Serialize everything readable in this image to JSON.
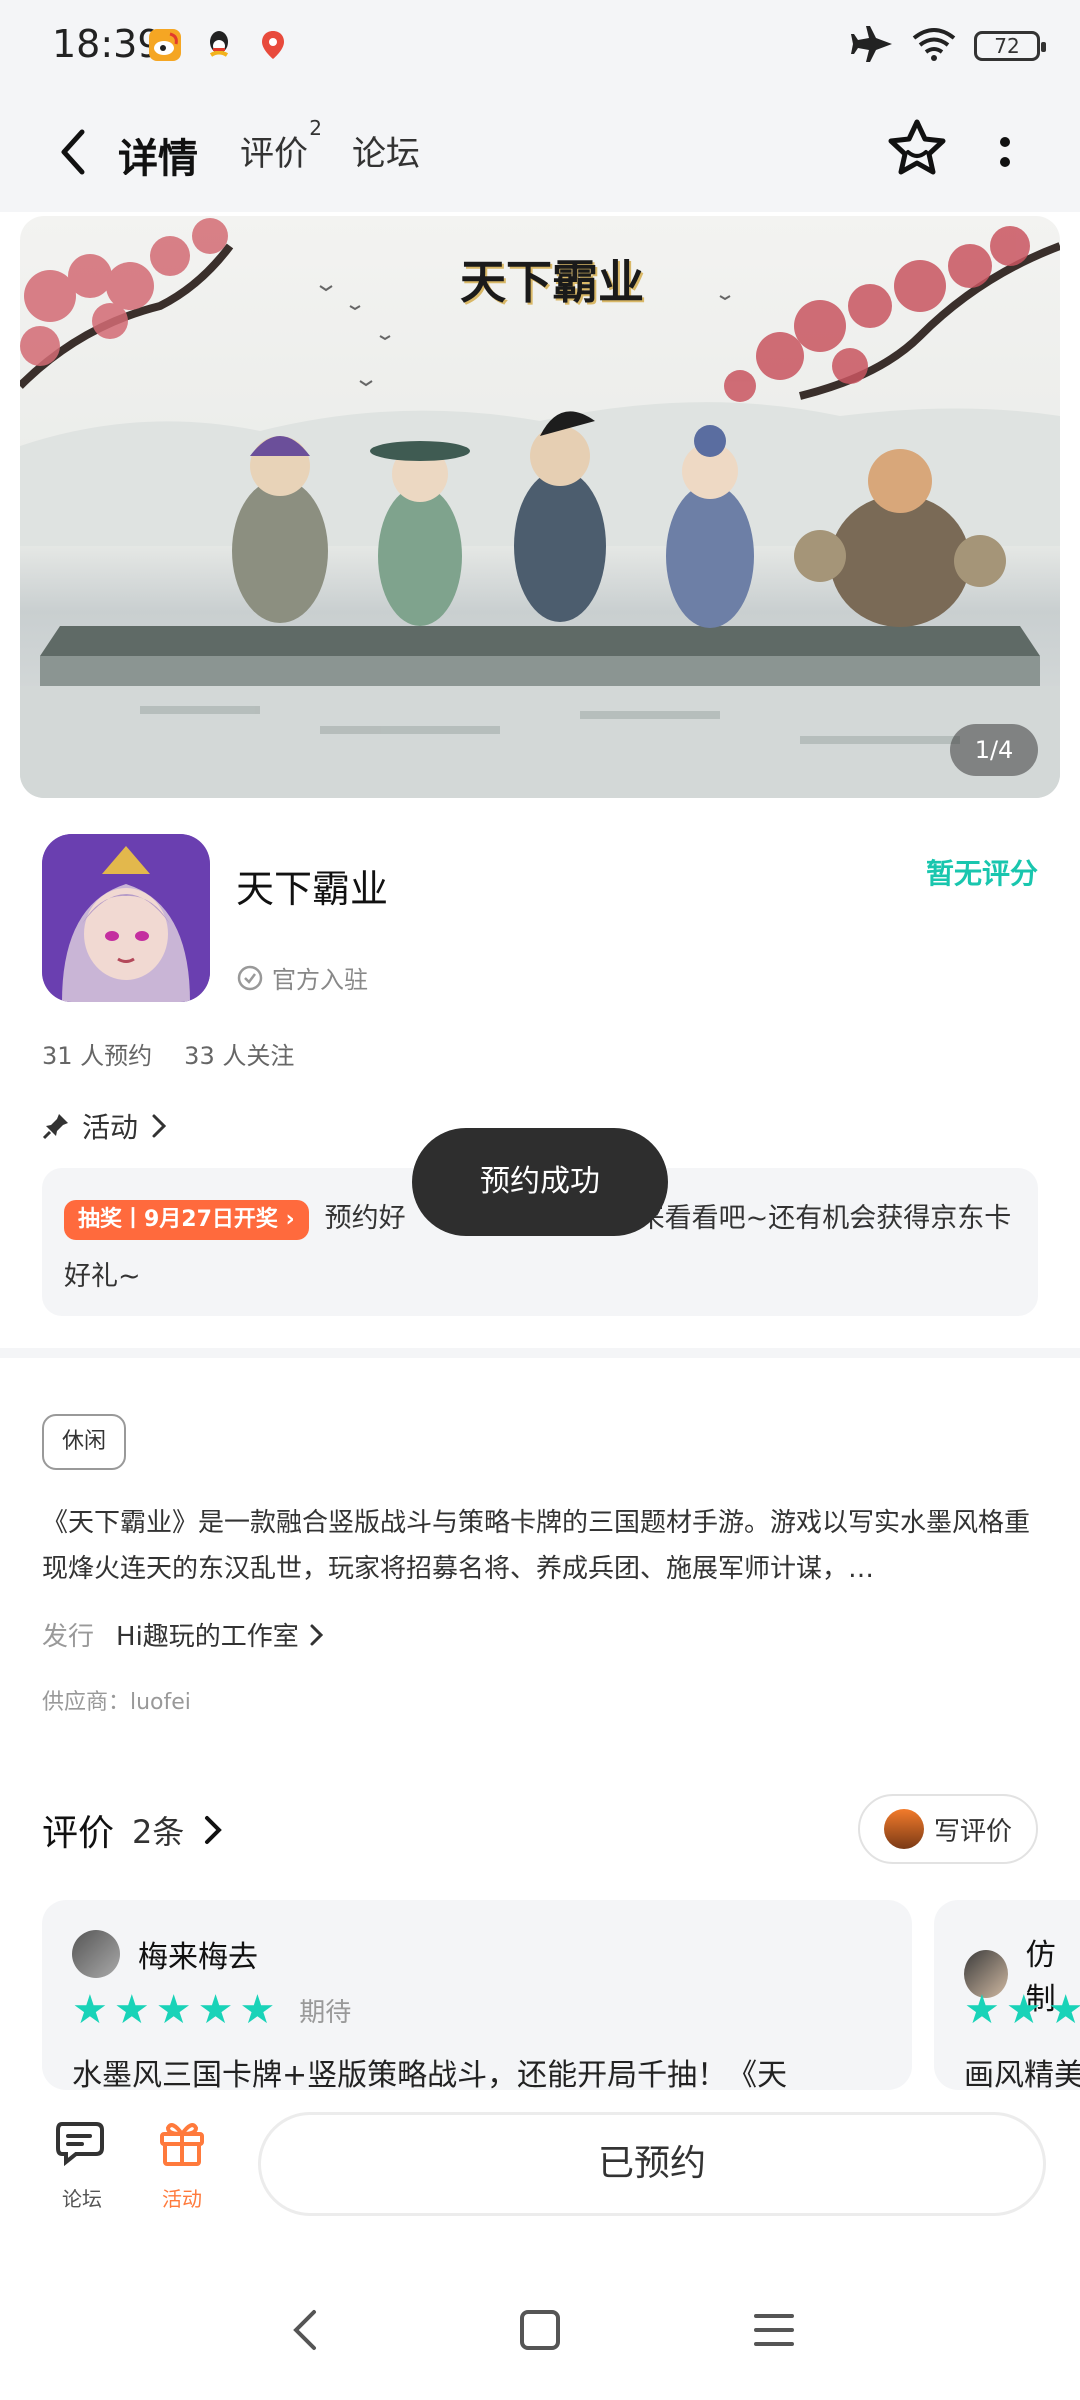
{
  "status_bar": {
    "time": "18:39",
    "battery": "72",
    "app_icons": [
      "weibo-icon",
      "qq-icon",
      "map-icon"
    ],
    "right_icons": [
      "airplane-icon",
      "wifi-icon",
      "battery-icon"
    ]
  },
  "nav": {
    "tabs": [
      {
        "label": "详情",
        "active": true
      },
      {
        "label": "评价",
        "badge": "2"
      },
      {
        "label": "论坛"
      }
    ]
  },
  "banner": {
    "logo_text": "天下霸业",
    "page_indicator": "1/4"
  },
  "game": {
    "name": "天下霸业",
    "official_label": "官方入驻",
    "rating_text": "暂无评分",
    "reservations": "31 人预约",
    "followers": "33 人关注"
  },
  "activity": {
    "heading": "活动",
    "badge": "抽奖丨9月27日开奖",
    "text_before": "预约好",
    "text_after": "来看看吧~还有机会获得京东卡好礼~"
  },
  "toast": "预约成功",
  "description": {
    "tag": "休闲",
    "text": "《天下霸业》是一款融合竖版战斗与策略卡牌的三国题材手游。游戏以写实水墨风格重现烽火连天的东汉乱世，玩家将招募名将、养成兵团、施展军师计谋，…",
    "publisher_label": "发行",
    "publisher_name": "Hi趣玩的工作室",
    "supplier": "供应商：luofei"
  },
  "reviews": {
    "title": "评价",
    "count": "2条",
    "write_label": "写评价",
    "items": [
      {
        "name": "梅来梅去",
        "status": "期待",
        "text": "水墨风三国卡牌+竖版策略战斗，还能开局千抽！《天"
      },
      {
        "name": "仿制",
        "text": "画风精美"
      }
    ]
  },
  "bottom_bar": {
    "forum_label": "论坛",
    "activity_label": "活动",
    "reserved_label": "已预约"
  },
  "colors": {
    "accent": "#19d3b8",
    "activity_orange": "#ff6a3d",
    "toast_bg": "#2e2e2e"
  }
}
